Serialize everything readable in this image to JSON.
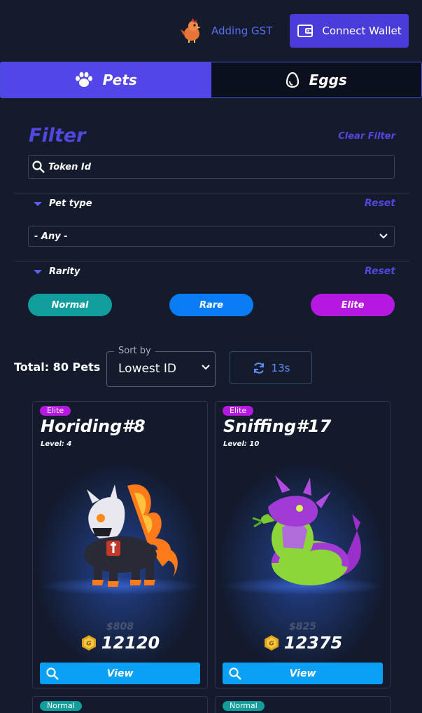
{
  "header": {
    "adding_gst": "Adding GST",
    "connect_wallet": "Connect Wallet"
  },
  "tabs": [
    {
      "label": "Pets",
      "icon": "paw-icon",
      "active": true
    },
    {
      "label": "Eggs",
      "icon": "egg-icon",
      "active": false
    }
  ],
  "filter": {
    "title": "Filter",
    "clear_label": "Clear Filter",
    "token_placeholder": "Token Id",
    "pet_type": {
      "label": "Pet type",
      "reset": "Reset",
      "selected": "- Any -"
    },
    "rarity": {
      "label": "Rarity",
      "reset": "Reset",
      "options": [
        "Normal",
        "Rare",
        "Elite"
      ]
    }
  },
  "listing": {
    "total": "Total: 80 Pets",
    "sort_label": "Sort by",
    "sort_value": "Lowest ID",
    "refresh": "13s"
  },
  "cards": [
    {
      "rarity": "Elite",
      "name": "Horiding#8",
      "level": "Level: 4",
      "usd": "$808",
      "gst": "12120",
      "view": "View"
    },
    {
      "rarity": "Elite",
      "name": "Sniffing#17",
      "level": "Level: 10",
      "usd": "$825",
      "gst": "12375",
      "view": "View"
    },
    {
      "rarity": "Normal"
    },
    {
      "rarity": "Normal"
    }
  ],
  "colors": {
    "background": "#141b2d",
    "accent": "#5346e8",
    "normal": "#139e9e",
    "rare": "#0a7cf5",
    "elite": "#b518e0",
    "view_button": "#0aa0f5"
  }
}
